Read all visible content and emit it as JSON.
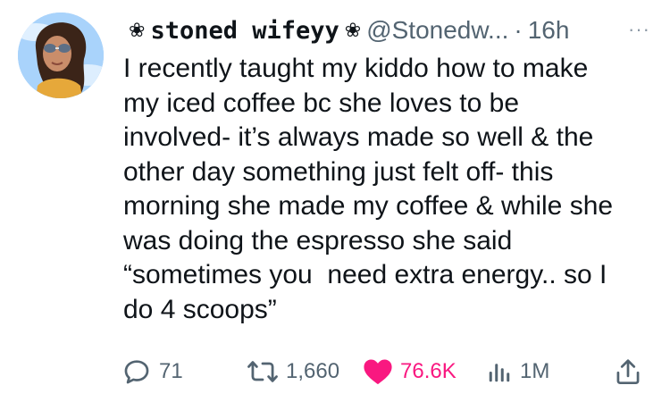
{
  "tweet": {
    "display_name": "stoned wifeyy",
    "name_decoration": "❀",
    "handle": "@Stonedw...",
    "separator": "·",
    "time": "16h",
    "more": "···",
    "text": "I recently taught my kiddo how to make\nmy iced coffee bc she loves to be\ninvolved- it’s always made so well & the\nother day something just felt off- this\nmorning she made my coffee & while she\nwas doing the espresso she said\n“sometimes you  need extra energy.. so I\ndo 4 scoops”"
  },
  "actions": {
    "replies": "71",
    "retweets": "1,660",
    "likes": "76.6K",
    "views": "1M"
  },
  "icons": {
    "reply": "reply-icon",
    "retweet": "retweet-icon",
    "like": "heart-icon",
    "views": "views-icon",
    "share": "share-icon"
  },
  "colors": {
    "text": "#0f1419",
    "muted": "#536471",
    "like": "#f91880"
  }
}
